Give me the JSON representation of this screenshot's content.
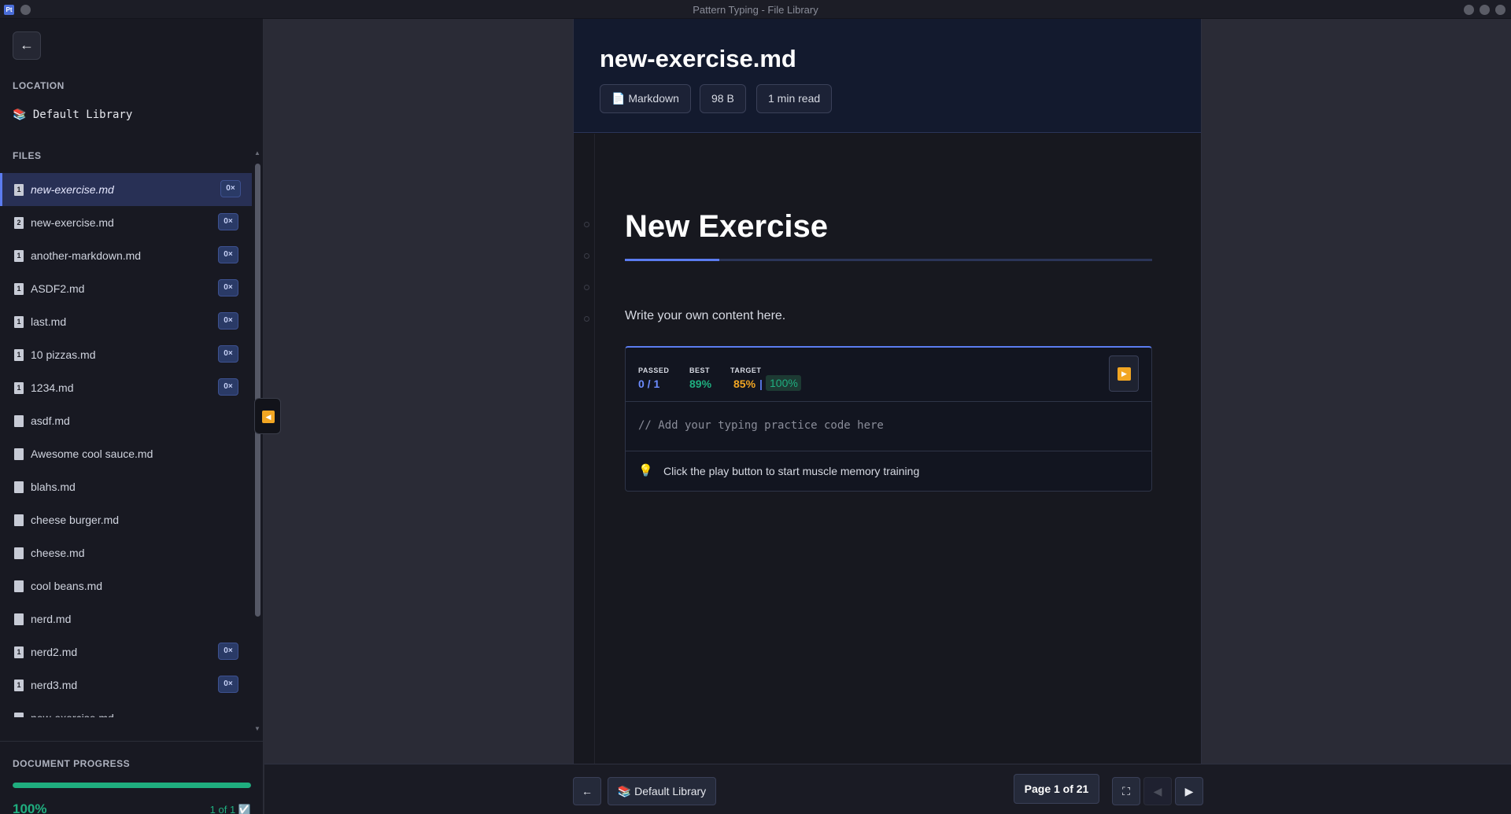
{
  "window": {
    "title": "Pattern Typing - File Library",
    "app_icon": "Pt"
  },
  "sidebar": {
    "back_label": "←",
    "location_label": "LOCATION",
    "location_name": "📚 Default Library",
    "files_label": "FILES",
    "files": [
      {
        "index": "1",
        "name": "new-exercise.md",
        "badge": "0×",
        "active": true
      },
      {
        "index": "2",
        "name": "new-exercise.md",
        "badge": "0×"
      },
      {
        "index": "1",
        "name": "another-markdown.md",
        "badge": "0×"
      },
      {
        "index": "1",
        "name": "ASDF2.md",
        "badge": "0×"
      },
      {
        "index": "1",
        "name": "last.md",
        "badge": "0×"
      },
      {
        "index": "1",
        "name": "10 pizzas.md",
        "badge": "0×"
      },
      {
        "index": "1",
        "name": "1234.md",
        "badge": "0×"
      },
      {
        "index": "",
        "name": "asdf.md",
        "badge": ""
      },
      {
        "index": "",
        "name": "Awesome cool sauce.md",
        "badge": ""
      },
      {
        "index": "",
        "name": "blahs.md",
        "badge": ""
      },
      {
        "index": "",
        "name": "cheese burger.md",
        "badge": ""
      },
      {
        "index": "",
        "name": "cheese.md",
        "badge": ""
      },
      {
        "index": "",
        "name": "cool beans.md",
        "badge": ""
      },
      {
        "index": "",
        "name": "nerd.md",
        "badge": ""
      },
      {
        "index": "1",
        "name": "nerd2.md",
        "badge": "0×"
      },
      {
        "index": "1",
        "name": "nerd3.md",
        "badge": "0×"
      },
      {
        "index": "",
        "name": "new-exercise.md",
        "badge": ""
      }
    ],
    "progress": {
      "label": "DOCUMENT PROGRESS",
      "percent_text": "100%",
      "percent_value": 100,
      "count_text": "1 of 1 ☑️"
    }
  },
  "document": {
    "filename": "new-exercise.md",
    "chips": [
      "📄 Markdown",
      "98 B",
      "1 min read"
    ],
    "heading": "New Exercise",
    "paragraph": "Write your own content here.",
    "exercise": {
      "passed_label": "PASSED",
      "passed_value": "0 / 1",
      "best_label": "BEST",
      "best_value": "89%",
      "target_label": "TARGET",
      "target_value": "85%",
      "separator": "|",
      "target_max": "100%",
      "code": "// Add your typing practice code here",
      "hint": "Click the play button to start muscle memory training",
      "hint_icon": "💡",
      "play_icon": "▶"
    }
  },
  "bottombar": {
    "back_label": "←",
    "library_label": "📚 Default Library",
    "page_indicator": "Page 1 of 21",
    "fullscreen_icon": "⛶",
    "prev_icon": "◀",
    "next_icon": "▶"
  },
  "colors": {
    "accent": "#5b7cf0",
    "success": "#1fae7f",
    "warning": "#f2a623",
    "passed": "#6c8cff"
  }
}
